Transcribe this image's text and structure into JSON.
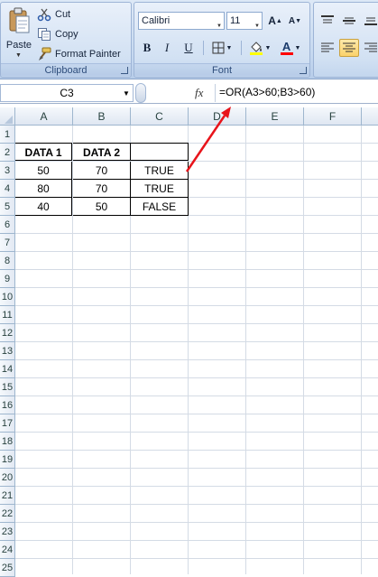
{
  "ribbon": {
    "clipboard": {
      "label": "Clipboard",
      "paste": "Paste",
      "cut": "Cut",
      "copy": "Copy",
      "format_painter": "Format Painter"
    },
    "font": {
      "label": "Font",
      "font_name": "Calibri",
      "font_size": "11",
      "bold": "B",
      "italic": "I",
      "underline": "U",
      "grow": "A",
      "shrink": "A",
      "font_color_glyph": "A",
      "fill_color": "#ffff00",
      "font_color": "#ff0000"
    }
  },
  "formula_bar": {
    "name_box": "C3",
    "fx": "fx",
    "formula": "=OR(A3>60;B3>60)"
  },
  "columns": [
    "A",
    "B",
    "C",
    "D",
    "E",
    "F"
  ],
  "rows": [
    "1",
    "2",
    "3",
    "4",
    "5",
    "6",
    "7",
    "8",
    "9",
    "10",
    "11",
    "12",
    "13",
    "14",
    "15",
    "16",
    "17",
    "18",
    "19",
    "20",
    "21",
    "22",
    "23",
    "24",
    "25"
  ],
  "table": {
    "headers": [
      "DATA 1",
      "DATA 2",
      ""
    ],
    "rows": [
      [
        "50",
        "70",
        "TRUE"
      ],
      [
        "80",
        "70",
        "TRUE"
      ],
      [
        "40",
        "50",
        "FALSE"
      ]
    ]
  },
  "colors": {
    "annotation_arrow": "#e8141b",
    "active_tab": "#fbd26b"
  }
}
